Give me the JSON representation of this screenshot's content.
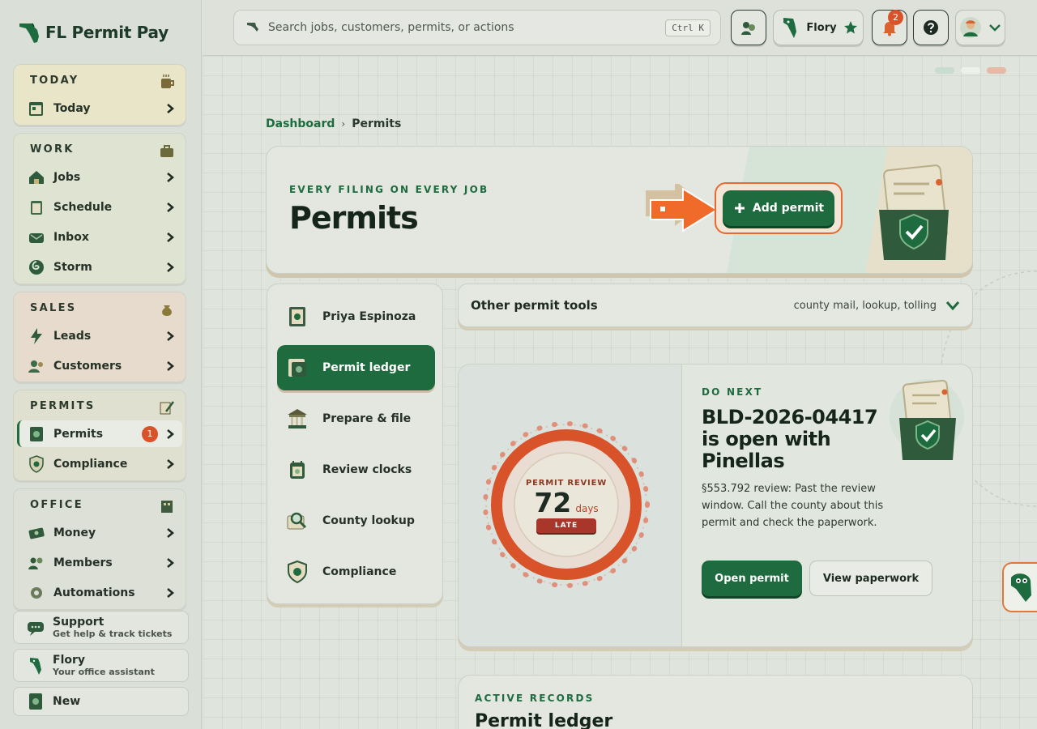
{
  "app": {
    "name": "FL Permit Pay"
  },
  "colors": {
    "brand_green": "#1d6b3e",
    "accent_orange": "#e86a32",
    "badge_red": "#d9532a"
  },
  "sidebar": {
    "groups": [
      {
        "title": "TODAY",
        "icon": "coffee-icon",
        "items": [
          {
            "label": "Today",
            "icon": "calendar-icon"
          }
        ]
      },
      {
        "title": "WORK",
        "icon": "toolbox-icon",
        "items": [
          {
            "label": "Jobs",
            "icon": "house-icon"
          },
          {
            "label": "Schedule",
            "icon": "clipboard-icon"
          },
          {
            "label": "Inbox",
            "icon": "mail-icon"
          },
          {
            "label": "Storm",
            "icon": "hurricane-icon"
          }
        ]
      },
      {
        "title": "SALES",
        "icon": "money-bag-icon",
        "items": [
          {
            "label": "Leads",
            "icon": "lightning-icon"
          },
          {
            "label": "Customers",
            "icon": "people-icon"
          }
        ]
      },
      {
        "title": "PERMITS",
        "icon": "pen-paper-icon",
        "items": [
          {
            "label": "Permits",
            "icon": "permit-icon",
            "badge": "1",
            "active": true
          },
          {
            "label": "Compliance",
            "icon": "shield-icon"
          }
        ]
      },
      {
        "title": "OFFICE",
        "icon": "building-icon",
        "items": [
          {
            "label": "Money",
            "icon": "cash-icon"
          },
          {
            "label": "Members",
            "icon": "members-icon"
          },
          {
            "label": "Automations",
            "icon": "gear-icon"
          }
        ]
      }
    ],
    "support": {
      "title": "Support",
      "subtitle": "Get help & track tickets"
    },
    "assistant": {
      "title": "Flory",
      "subtitle": "Your office assistant"
    },
    "new": {
      "title": "New"
    }
  },
  "topbar": {
    "search_placeholder": "Search jobs, customers, permits, or actions",
    "search_shortcut": "Ctrl K",
    "assistant_name": "Flory",
    "notification_count": "2"
  },
  "breadcrumb": {
    "root": "Dashboard",
    "separator": "›",
    "current": "Permits"
  },
  "hero": {
    "eyebrow": "EVERY FILING ON EVERY JOB",
    "title": "Permits",
    "add_button": "Add permit"
  },
  "subnav": {
    "items": [
      {
        "label": "Priya Espinoza",
        "icon": "permit-doc-icon"
      },
      {
        "label": "Permit ledger",
        "icon": "ledger-icon",
        "active": true
      },
      {
        "label": "Prepare & file",
        "icon": "courthouse-icon"
      },
      {
        "label": "Review clocks",
        "icon": "clock-icon"
      },
      {
        "label": "County lookup",
        "icon": "magnifier-icon"
      },
      {
        "label": "Compliance",
        "icon": "shield-icon"
      }
    ]
  },
  "tools": {
    "title": "Other permit tools",
    "subtitle": "county mail, lookup, tolling"
  },
  "do_next": {
    "gauge": {
      "label": "PERMIT REVIEW",
      "value": "72",
      "unit": "days",
      "status": "LATE"
    },
    "eyebrow": "DO NEXT",
    "title": "BLD-2026-04417 is open with Pinellas",
    "description": "§553.792 review: Past the review window. Call the county about this permit and check the paperwork.",
    "primary_button": "Open permit",
    "secondary_button": "View paperwork"
  },
  "records": {
    "eyebrow": "ACTIVE RECORDS",
    "title": "Permit ledger"
  }
}
